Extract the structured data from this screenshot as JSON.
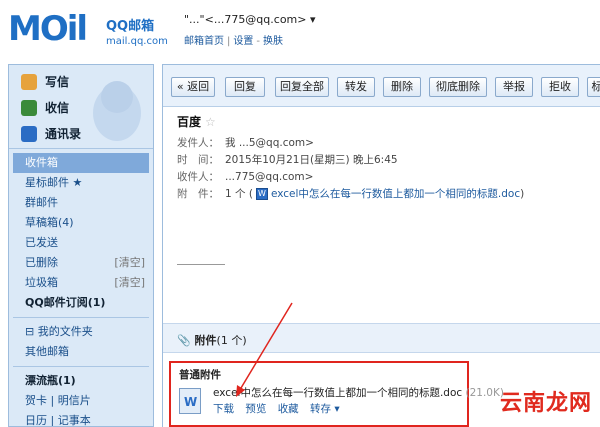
{
  "header": {
    "logo_text": "MOil",
    "logo_cn": "QQ邮箱",
    "logo_url": "mail.qq.com",
    "account": "\"...\"<...775@qq.com>",
    "dropdown_glyph": "▾",
    "links": [
      "邮箱首页",
      "设置",
      "换肤"
    ]
  },
  "sidebar": {
    "top_buttons": [
      {
        "label": "写信",
        "icon": "pencil-icon",
        "color": "#e6a23c"
      },
      {
        "label": "收信",
        "icon": "inbox-download-icon",
        "color": "#3a8a3a"
      },
      {
        "label": "通讯录",
        "icon": "contacts-icon",
        "color": "#2a6cc4"
      }
    ],
    "folders": [
      {
        "label": "收件箱",
        "active": true
      },
      {
        "label": "星标邮件 ★"
      },
      {
        "label": "群邮件"
      },
      {
        "label": "草稿箱(4)"
      },
      {
        "label": "已发送"
      },
      {
        "label": "已删除",
        "action": "[清空]"
      },
      {
        "label": "垃圾箱",
        "action": "[清空]"
      },
      {
        "label": "QQ邮件订阅(1)",
        "bold": true
      }
    ],
    "extra": [
      {
        "label": "⊟ 我的文件夹"
      },
      {
        "label": "其他邮箱"
      }
    ],
    "tools": [
      {
        "label": "漂流瓶(1)",
        "bold": true
      },
      {
        "label": "贺卡 | 明信片"
      },
      {
        "label": "日历 | 记事本"
      }
    ]
  },
  "toolbar": {
    "buttons": [
      "« 返回",
      "回复",
      "回复全部",
      "转发",
      "删除",
      "彻底删除",
      "举报",
      "拒收",
      "标"
    ]
  },
  "email": {
    "subject": "百度",
    "star": "☆",
    "from_label": "发件人：",
    "from_value": "我 ...5@qq.com>",
    "time_label": "时　间：",
    "time_value": "2015年10月21日(星期三) 晚上6:45",
    "to_label": "收件人：",
    "to_value": "...775@qq.com>",
    "attach_label": "附　件：",
    "attach_count": "1 个 (",
    "attach_name": "excel中怎么在每一行数值上都加一个相同的标题.doc",
    "attach_close": ")"
  },
  "attachments": {
    "section_title": "附件",
    "section_count": "(1 个)",
    "group_title": "普通附件",
    "file_name": "excel中怎么在每一行数值上都加一个相同的标题.doc",
    "file_size": "(21.0K)",
    "actions": [
      "下载",
      "预览",
      "收藏",
      "转存 ▾"
    ]
  },
  "watermark": "云南龙网",
  "colors": {
    "accent": "#1f6fc4",
    "highlight": "#e0251e"
  }
}
